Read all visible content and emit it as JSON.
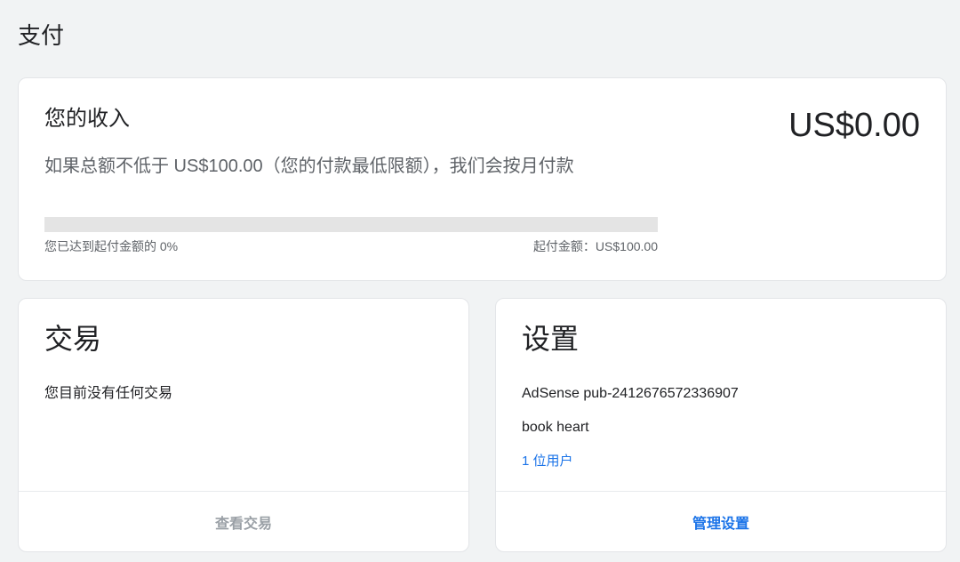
{
  "page": {
    "title": "支付"
  },
  "earnings": {
    "title": "您的收入",
    "amount": "US$0.00",
    "description": "如果总额不低于 US$100.00（您的付款最低限额），我们会按月付款",
    "progress_fraction": 0,
    "progress_label": "您已达到起付金额的 0%",
    "threshold_label": "起付金额：US$100.00",
    "progress_track_color": "#e4e4e4"
  },
  "transactions": {
    "title": "交易",
    "empty_message": "您目前没有任何交易",
    "view_button": "查看交易"
  },
  "settings": {
    "title": "设置",
    "publisher_id": "AdSense pub-2412676572336907",
    "account_name": "book heart",
    "users_link": "1 位用户",
    "manage_button": "管理设置"
  },
  "colors": {
    "accent": "#1a73e8",
    "disabled_text": "#9aa0a6",
    "background": "#f1f3f4"
  }
}
